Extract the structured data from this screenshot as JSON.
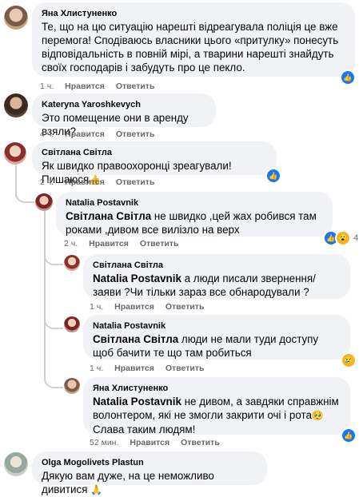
{
  "labels": {
    "like": "Нравится",
    "reply": "Ответить"
  },
  "colors": {
    "bubble": "#f0f2f5",
    "like_blue": "#1877f2",
    "meta_gray": "#65676b"
  },
  "comments": [
    {
      "author": "Яна Хлистуненко",
      "text": "Те, що на цю ситуацію нарешті відреагувала поліція це вже перемога! Сподіваюсь власники цього «притулку» понесуть відповідальність в повній мірі, а тварини нарешті знайдуть своїх господарів і забудуть про це пекло.",
      "time": "1 ч.",
      "reaction": "like-icon"
    },
    {
      "author": "Kateryna Yaroshkevych",
      "text": "Это помещение они в аренду взяли?",
      "time": "4 ч."
    },
    {
      "author": "Світлана Світла",
      "text": "Як швидко правоохоронці зреагували!Пишаюся",
      "emoji": "👍",
      "time": "2 ч.",
      "reaction": "like-icon"
    },
    {
      "author": "Natalia Postavnik",
      "mention": "Світлана Світла",
      "text": " не швидко ,цей жах робився там роками ,дивом все вилізло на верх",
      "time": "2 ч.",
      "reaction_count": "4"
    },
    {
      "author": "Світлана Світла",
      "mention": "Natalia Postavnik",
      "text": " а люди писали звернення/заяви ?Чи тільки зараз все обнародували ?",
      "time": "1 ч."
    },
    {
      "author": "Natalia Postavnik",
      "mention": "Світлана Світла",
      "text": " люди не мали туди доступу щоб бачити те що там робиться",
      "time": "1 ч.",
      "reaction": "sad-icon"
    },
    {
      "author": "Яна Хлистуненко",
      "mention": "Natalia Postavnik",
      "text": " не дивом, а завдяки справжнім волонтером, які не змогли закрити очі і рота",
      "text_after": " Слава таким людям!",
      "emoji": "🥺",
      "time": "52 мин.",
      "reaction": "like-icon"
    },
    {
      "author": "Olga Mogolivets Plastun",
      "text": "Дякую вам дуже, на це неможливо дивитися",
      "emoji": "🙏"
    }
  ]
}
